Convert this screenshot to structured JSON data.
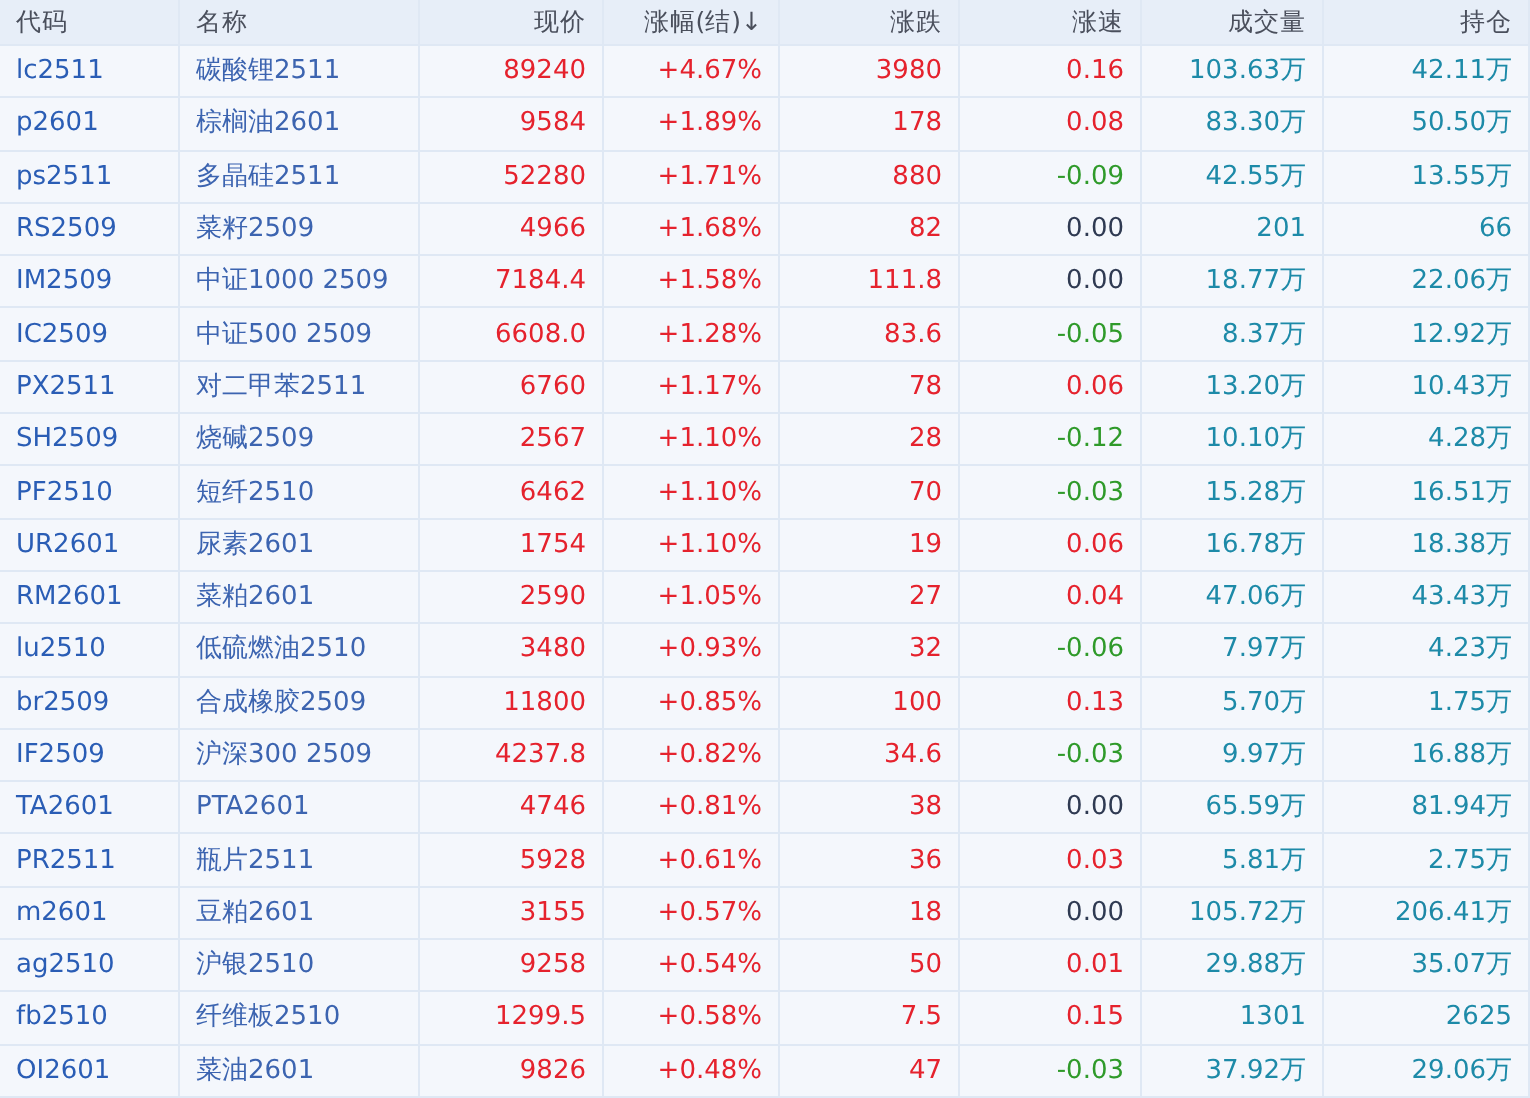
{
  "table": {
    "columns": [
      "代码",
      "名称",
      "现价",
      "涨幅(结)↓",
      "涨跌",
      "涨速",
      "成交量",
      "持仓"
    ],
    "rows": [
      {
        "code": "lc2511",
        "name": "碳酸锂2511",
        "price": "89240",
        "pct": "+4.67%",
        "change": "3980",
        "color": "#e5222d",
        "speed": {
          "text": "0.16",
          "color": "#e5222d"
        },
        "volume": "103.63万",
        "open_interest": "42.11万"
      },
      {
        "code": "p2601",
        "name": "棕榈油2601",
        "price": "9584",
        "pct": "+1.89%",
        "change": "178",
        "color": "#e5222d",
        "speed": {
          "text": "0.08",
          "color": "#e5222d"
        },
        "volume": "83.30万",
        "open_interest": "50.50万"
      },
      {
        "code": "ps2511",
        "name": "多晶硅2511",
        "price": "52280",
        "pct": "+1.71%",
        "change": "880",
        "color": "#e5222d",
        "speed": {
          "text": "-0.09",
          "color": "#2f9a2a"
        },
        "volume": "42.55万",
        "open_interest": "13.55万"
      },
      {
        "code": "RS2509",
        "name": "菜籽2509",
        "price": "4966",
        "pct": "+1.68%",
        "change": "82",
        "color": "#e5222d",
        "speed": {
          "text": "0.00",
          "color": "#2f3a52"
        },
        "volume": "201",
        "open_interest": "66"
      },
      {
        "code": "IM2509",
        "name": "中证1000 2509",
        "price": "7184.4",
        "pct": "+1.58%",
        "change": "111.8",
        "color": "#e5222d",
        "speed": {
          "text": "0.00",
          "color": "#2f3a52"
        },
        "volume": "18.77万",
        "open_interest": "22.06万"
      },
      {
        "code": "IC2509",
        "name": "中证500 2509",
        "price": "6608.0",
        "pct": "+1.28%",
        "change": "83.6",
        "color": "#e5222d",
        "speed": {
          "text": "-0.05",
          "color": "#2f9a2a"
        },
        "volume": "8.37万",
        "open_interest": "12.92万"
      },
      {
        "code": "PX2511",
        "name": "对二甲苯2511",
        "price": "6760",
        "pct": "+1.17%",
        "change": "78",
        "color": "#e5222d",
        "speed": {
          "text": "0.06",
          "color": "#e5222d"
        },
        "volume": "13.20万",
        "open_interest": "10.43万"
      },
      {
        "code": "SH2509",
        "name": "烧碱2509",
        "price": "2567",
        "pct": "+1.10%",
        "change": "28",
        "color": "#e5222d",
        "speed": {
          "text": "-0.12",
          "color": "#2f9a2a"
        },
        "volume": "10.10万",
        "open_interest": "4.28万"
      },
      {
        "code": "PF2510",
        "name": "短纤2510",
        "price": "6462",
        "pct": "+1.10%",
        "change": "70",
        "color": "#e5222d",
        "speed": {
          "text": "-0.03",
          "color": "#2f9a2a"
        },
        "volume": "15.28万",
        "open_interest": "16.51万"
      },
      {
        "code": "UR2601",
        "name": "尿素2601",
        "price": "1754",
        "pct": "+1.10%",
        "change": "19",
        "color": "#e5222d",
        "speed": {
          "text": "0.06",
          "color": "#e5222d"
        },
        "volume": "16.78万",
        "open_interest": "18.38万"
      },
      {
        "code": "RM2601",
        "name": "菜粕2601",
        "price": "2590",
        "pct": "+1.05%",
        "change": "27",
        "color": "#e5222d",
        "speed": {
          "text": "0.04",
          "color": "#e5222d"
        },
        "volume": "47.06万",
        "open_interest": "43.43万"
      },
      {
        "code": "lu2510",
        "name": "低硫燃油2510",
        "price": "3480",
        "pct": "+0.93%",
        "change": "32",
        "color": "#e5222d",
        "speed": {
          "text": "-0.06",
          "color": "#2f9a2a"
        },
        "volume": "7.97万",
        "open_interest": "4.23万"
      },
      {
        "code": "br2509",
        "name": "合成橡胶2509",
        "price": "11800",
        "pct": "+0.85%",
        "change": "100",
        "color": "#e5222d",
        "speed": {
          "text": "0.13",
          "color": "#e5222d"
        },
        "volume": "5.70万",
        "open_interest": "1.75万"
      },
      {
        "code": "IF2509",
        "name": "沪深300 2509",
        "price": "4237.8",
        "pct": "+0.82%",
        "change": "34.6",
        "color": "#e5222d",
        "speed": {
          "text": "-0.03",
          "color": "#2f9a2a"
        },
        "volume": "9.97万",
        "open_interest": "16.88万"
      },
      {
        "code": "TA2601",
        "name": "PTA2601",
        "price": "4746",
        "pct": "+0.81%",
        "change": "38",
        "color": "#e5222d",
        "speed": {
          "text": "0.00",
          "color": "#2f3a52"
        },
        "volume": "65.59万",
        "open_interest": "81.94万"
      },
      {
        "code": "PR2511",
        "name": "瓶片2511",
        "price": "5928",
        "pct": "+0.61%",
        "change": "36",
        "color": "#e5222d",
        "speed": {
          "text": "0.03",
          "color": "#e5222d"
        },
        "volume": "5.81万",
        "open_interest": "2.75万"
      },
      {
        "code": "m2601",
        "name": "豆粕2601",
        "price": "3155",
        "pct": "+0.57%",
        "change": "18",
        "color": "#e5222d",
        "speed": {
          "text": "0.00",
          "color": "#2f3a52"
        },
        "volume": "105.72万",
        "open_interest": "206.41万"
      },
      {
        "code": "ag2510",
        "name": "沪银2510",
        "price": "9258",
        "pct": "+0.54%",
        "change": "50",
        "color": "#e5222d",
        "speed": {
          "text": "0.01",
          "color": "#e5222d"
        },
        "volume": "29.88万",
        "open_interest": "35.07万"
      },
      {
        "code": "fb2510",
        "name": "纤维板2510",
        "price": "1299.5",
        "pct": "+0.58%",
        "change": "7.5",
        "color": "#e5222d",
        "speed": {
          "text": "0.15",
          "color": "#e5222d"
        },
        "volume": "1301",
        "open_interest": "2625"
      },
      {
        "code": "OI2601",
        "name": "菜油2601",
        "price": "9826",
        "pct": "+0.48%",
        "change": "47",
        "color": "#e5222d",
        "speed": {
          "text": "-0.03",
          "color": "#2f9a2a"
        },
        "volume": "37.92万",
        "open_interest": "29.06万"
      }
    ]
  }
}
